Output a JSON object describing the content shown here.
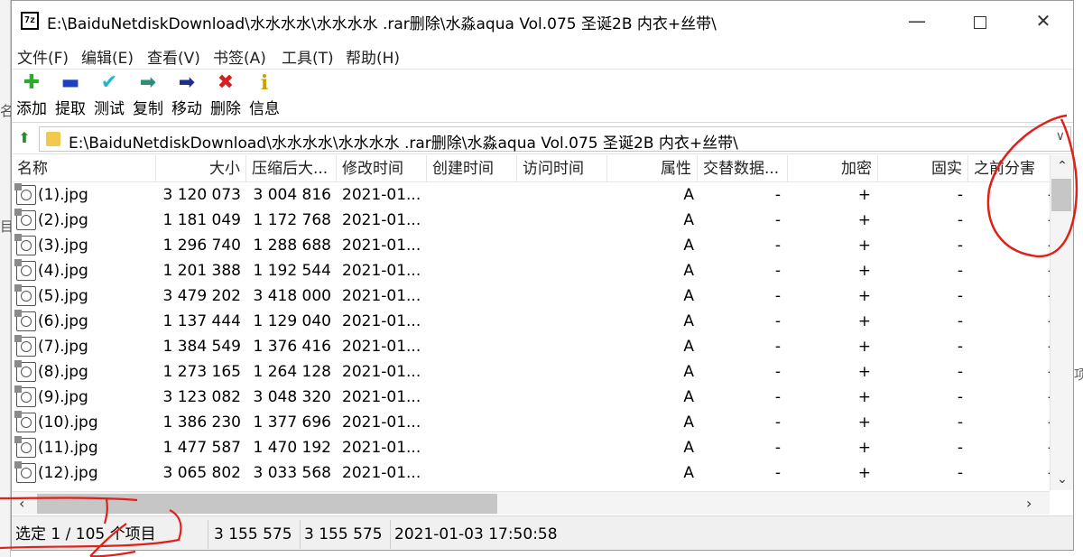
{
  "background": {
    "left_fragments": [
      "名",
      "目"
    ],
    "right_fragment": "项"
  },
  "window": {
    "title": "E:\\BaiduNetdiskDownload\\水水水水\\水水水水 .rar删除\\水淼aqua Vol.075 圣诞2B 内衣+丝带\\",
    "app_icon_text": "7z",
    "controls": {
      "minimize": "—",
      "maximize": "",
      "close": "✕"
    }
  },
  "menu": {
    "items": [
      "文件(F)",
      "编辑(E)",
      "查看(V)",
      "书签(A)",
      "工具(T)",
      "帮助(H)"
    ]
  },
  "toolbar": {
    "buttons": [
      {
        "label": "添加",
        "icon": "plus-icon",
        "glyph": "✚",
        "color": "#2faa2f"
      },
      {
        "label": "提取",
        "icon": "minus-icon",
        "glyph": "▬",
        "color": "#1c3fc4"
      },
      {
        "label": "测试",
        "icon": "test-check-icon",
        "glyph": "✔",
        "color": "#21b8c8"
      },
      {
        "label": "复制",
        "icon": "copy-arrow-icon",
        "glyph": "➡",
        "color": "#2a8f7a"
      },
      {
        "label": "移动",
        "icon": "move-arrow-icon",
        "glyph": "➡",
        "color": "#1c2f8f"
      },
      {
        "label": "删除",
        "icon": "delete-x-icon",
        "glyph": "✖",
        "color": "#d42020"
      },
      {
        "label": "信息",
        "icon": "info-icon",
        "glyph": "i",
        "color": "#c9a400"
      }
    ]
  },
  "address": {
    "path": "E:\\BaiduNetdiskDownload\\水水水水\\水水水水 .rar删除\\水淼aqua Vol.075 圣诞2B 内衣+丝带\\",
    "dropdown": "∨"
  },
  "list": {
    "columns": [
      "名称",
      "大小",
      "压缩后大...",
      "修改时间",
      "创建时间",
      "访问时间",
      "属性",
      "交替数据...",
      "加密",
      "固实",
      "之前分害"
    ],
    "rows": [
      {
        "name": "(1).jpg",
        "size": "3 120 073",
        "packed": "3 004 816",
        "modified": "2021-01...",
        "created": "",
        "accessed": "",
        "attr": "A",
        "alt": "-",
        "enc": "+",
        "solid": "-",
        "prev": "-"
      },
      {
        "name": "(2).jpg",
        "size": "1 181 049",
        "packed": "1 172 768",
        "modified": "2021-01...",
        "created": "",
        "accessed": "",
        "attr": "A",
        "alt": "-",
        "enc": "+",
        "solid": "-",
        "prev": "-"
      },
      {
        "name": "(3).jpg",
        "size": "1 296 740",
        "packed": "1 288 688",
        "modified": "2021-01...",
        "created": "",
        "accessed": "",
        "attr": "A",
        "alt": "-",
        "enc": "+",
        "solid": "-",
        "prev": "-"
      },
      {
        "name": "(4).jpg",
        "size": "1 201 388",
        "packed": "1 192 544",
        "modified": "2021-01...",
        "created": "",
        "accessed": "",
        "attr": "A",
        "alt": "-",
        "enc": "+",
        "solid": "-",
        "prev": "-"
      },
      {
        "name": "(5).jpg",
        "size": "3 479 202",
        "packed": "3 418 000",
        "modified": "2021-01...",
        "created": "",
        "accessed": "",
        "attr": "A",
        "alt": "-",
        "enc": "+",
        "solid": "-",
        "prev": "-"
      },
      {
        "name": "(6).jpg",
        "size": "1 137 444",
        "packed": "1 129 040",
        "modified": "2021-01...",
        "created": "",
        "accessed": "",
        "attr": "A",
        "alt": "-",
        "enc": "+",
        "solid": "-",
        "prev": "-"
      },
      {
        "name": "(7).jpg",
        "size": "1 384 549",
        "packed": "1 376 416",
        "modified": "2021-01...",
        "created": "",
        "accessed": "",
        "attr": "A",
        "alt": "-",
        "enc": "+",
        "solid": "-",
        "prev": "-"
      },
      {
        "name": "(8).jpg",
        "size": "1 273 165",
        "packed": "1 264 128",
        "modified": "2021-01...",
        "created": "",
        "accessed": "",
        "attr": "A",
        "alt": "-",
        "enc": "+",
        "solid": "-",
        "prev": "-"
      },
      {
        "name": "(9).jpg",
        "size": "3 123 082",
        "packed": "3 048 320",
        "modified": "2021-01...",
        "created": "",
        "accessed": "",
        "attr": "A",
        "alt": "-",
        "enc": "+",
        "solid": "-",
        "prev": "-"
      },
      {
        "name": "(10).jpg",
        "size": "1 386 230",
        "packed": "1 377 696",
        "modified": "2021-01...",
        "created": "",
        "accessed": "",
        "attr": "A",
        "alt": "-",
        "enc": "+",
        "solid": "-",
        "prev": "-"
      },
      {
        "name": "(11).jpg",
        "size": "1 477 587",
        "packed": "1 470 192",
        "modified": "2021-01...",
        "created": "",
        "accessed": "",
        "attr": "A",
        "alt": "-",
        "enc": "+",
        "solid": "-",
        "prev": "-"
      },
      {
        "name": "(12).jpg",
        "size": "3 065 802",
        "packed": "3 033 568",
        "modified": "2021-01...",
        "created": "",
        "accessed": "",
        "attr": "A",
        "alt": "-",
        "enc": "+",
        "solid": "-",
        "prev": "-"
      }
    ]
  },
  "scrollbars": {
    "v_up": "⌃",
    "v_down": "⌄",
    "h_left": "‹",
    "h_right": "›"
  },
  "status": {
    "selection": "选定 1 / 105 个项目",
    "size": "3 155 575",
    "packed": "3 155 575",
    "modified": "2021-01-03 17:50:58"
  },
  "annotation_color": "#e0201a"
}
